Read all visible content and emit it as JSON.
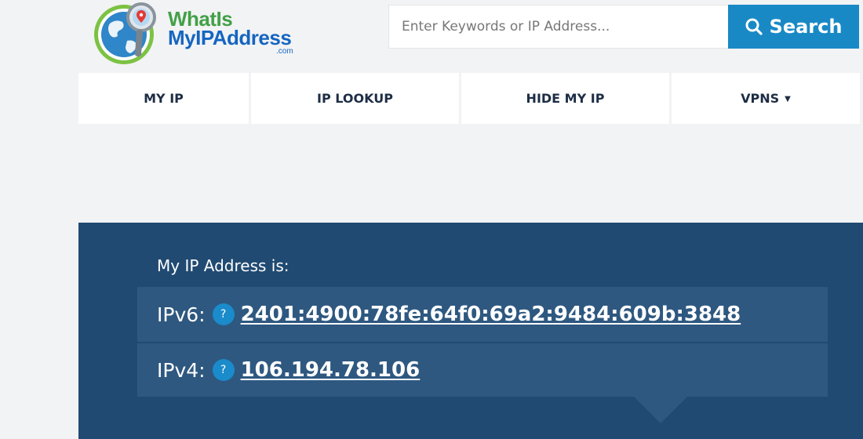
{
  "header": {
    "logo": {
      "line1": "WhatIs",
      "line2": "MyIPAddress",
      "suffix": ".com"
    },
    "search": {
      "placeholder": "Enter Keywords or IP Address...",
      "button_label": "Search",
      "button_icon": "search-icon"
    }
  },
  "nav": {
    "items": [
      {
        "label": "MY IP"
      },
      {
        "label": "IP LOOKUP"
      },
      {
        "label": "HIDE MY IP"
      },
      {
        "label": "VPNS",
        "caret": "▼"
      }
    ]
  },
  "hero": {
    "title": "My IP Address is:",
    "ipv6": {
      "label": "IPv6:",
      "help": "?",
      "value": "2401:4900:78fe:64f0:69a2:9484:609b:3848"
    },
    "ipv4": {
      "label": "IPv4:",
      "help": "?",
      "value": "106.194.78.106"
    }
  },
  "colors": {
    "brand_green": "#43a047",
    "brand_blue": "#1565c0",
    "search_button": "#1989c6",
    "hero_bg": "#204a72",
    "ip_row_bg": "#2e5880",
    "help_badge": "#1a8bcb"
  }
}
